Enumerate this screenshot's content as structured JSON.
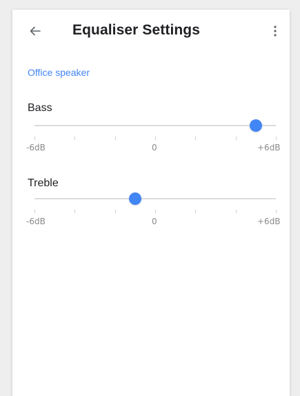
{
  "app_bar": {
    "title": "Equaliser Settings",
    "back_icon": "arrow-back-icon",
    "menu_icon": "more-vert-icon"
  },
  "device": {
    "name": "Office speaker"
  },
  "equaliser": {
    "bass": {
      "label": "Bass",
      "value_db": 5,
      "min_label": "-6dB",
      "mid_label": "0",
      "max_label": "+6dB"
    },
    "treble": {
      "label": "Treble",
      "value_db": -1,
      "min_label": "-6dB",
      "mid_label": "0",
      "max_label": "+6dB"
    },
    "min_db": -6,
    "max_db": 6
  },
  "colors": {
    "accent": "#4285f4",
    "track": "#dadce0",
    "text_primary": "#202124",
    "text_secondary": "#8a8a8a"
  }
}
